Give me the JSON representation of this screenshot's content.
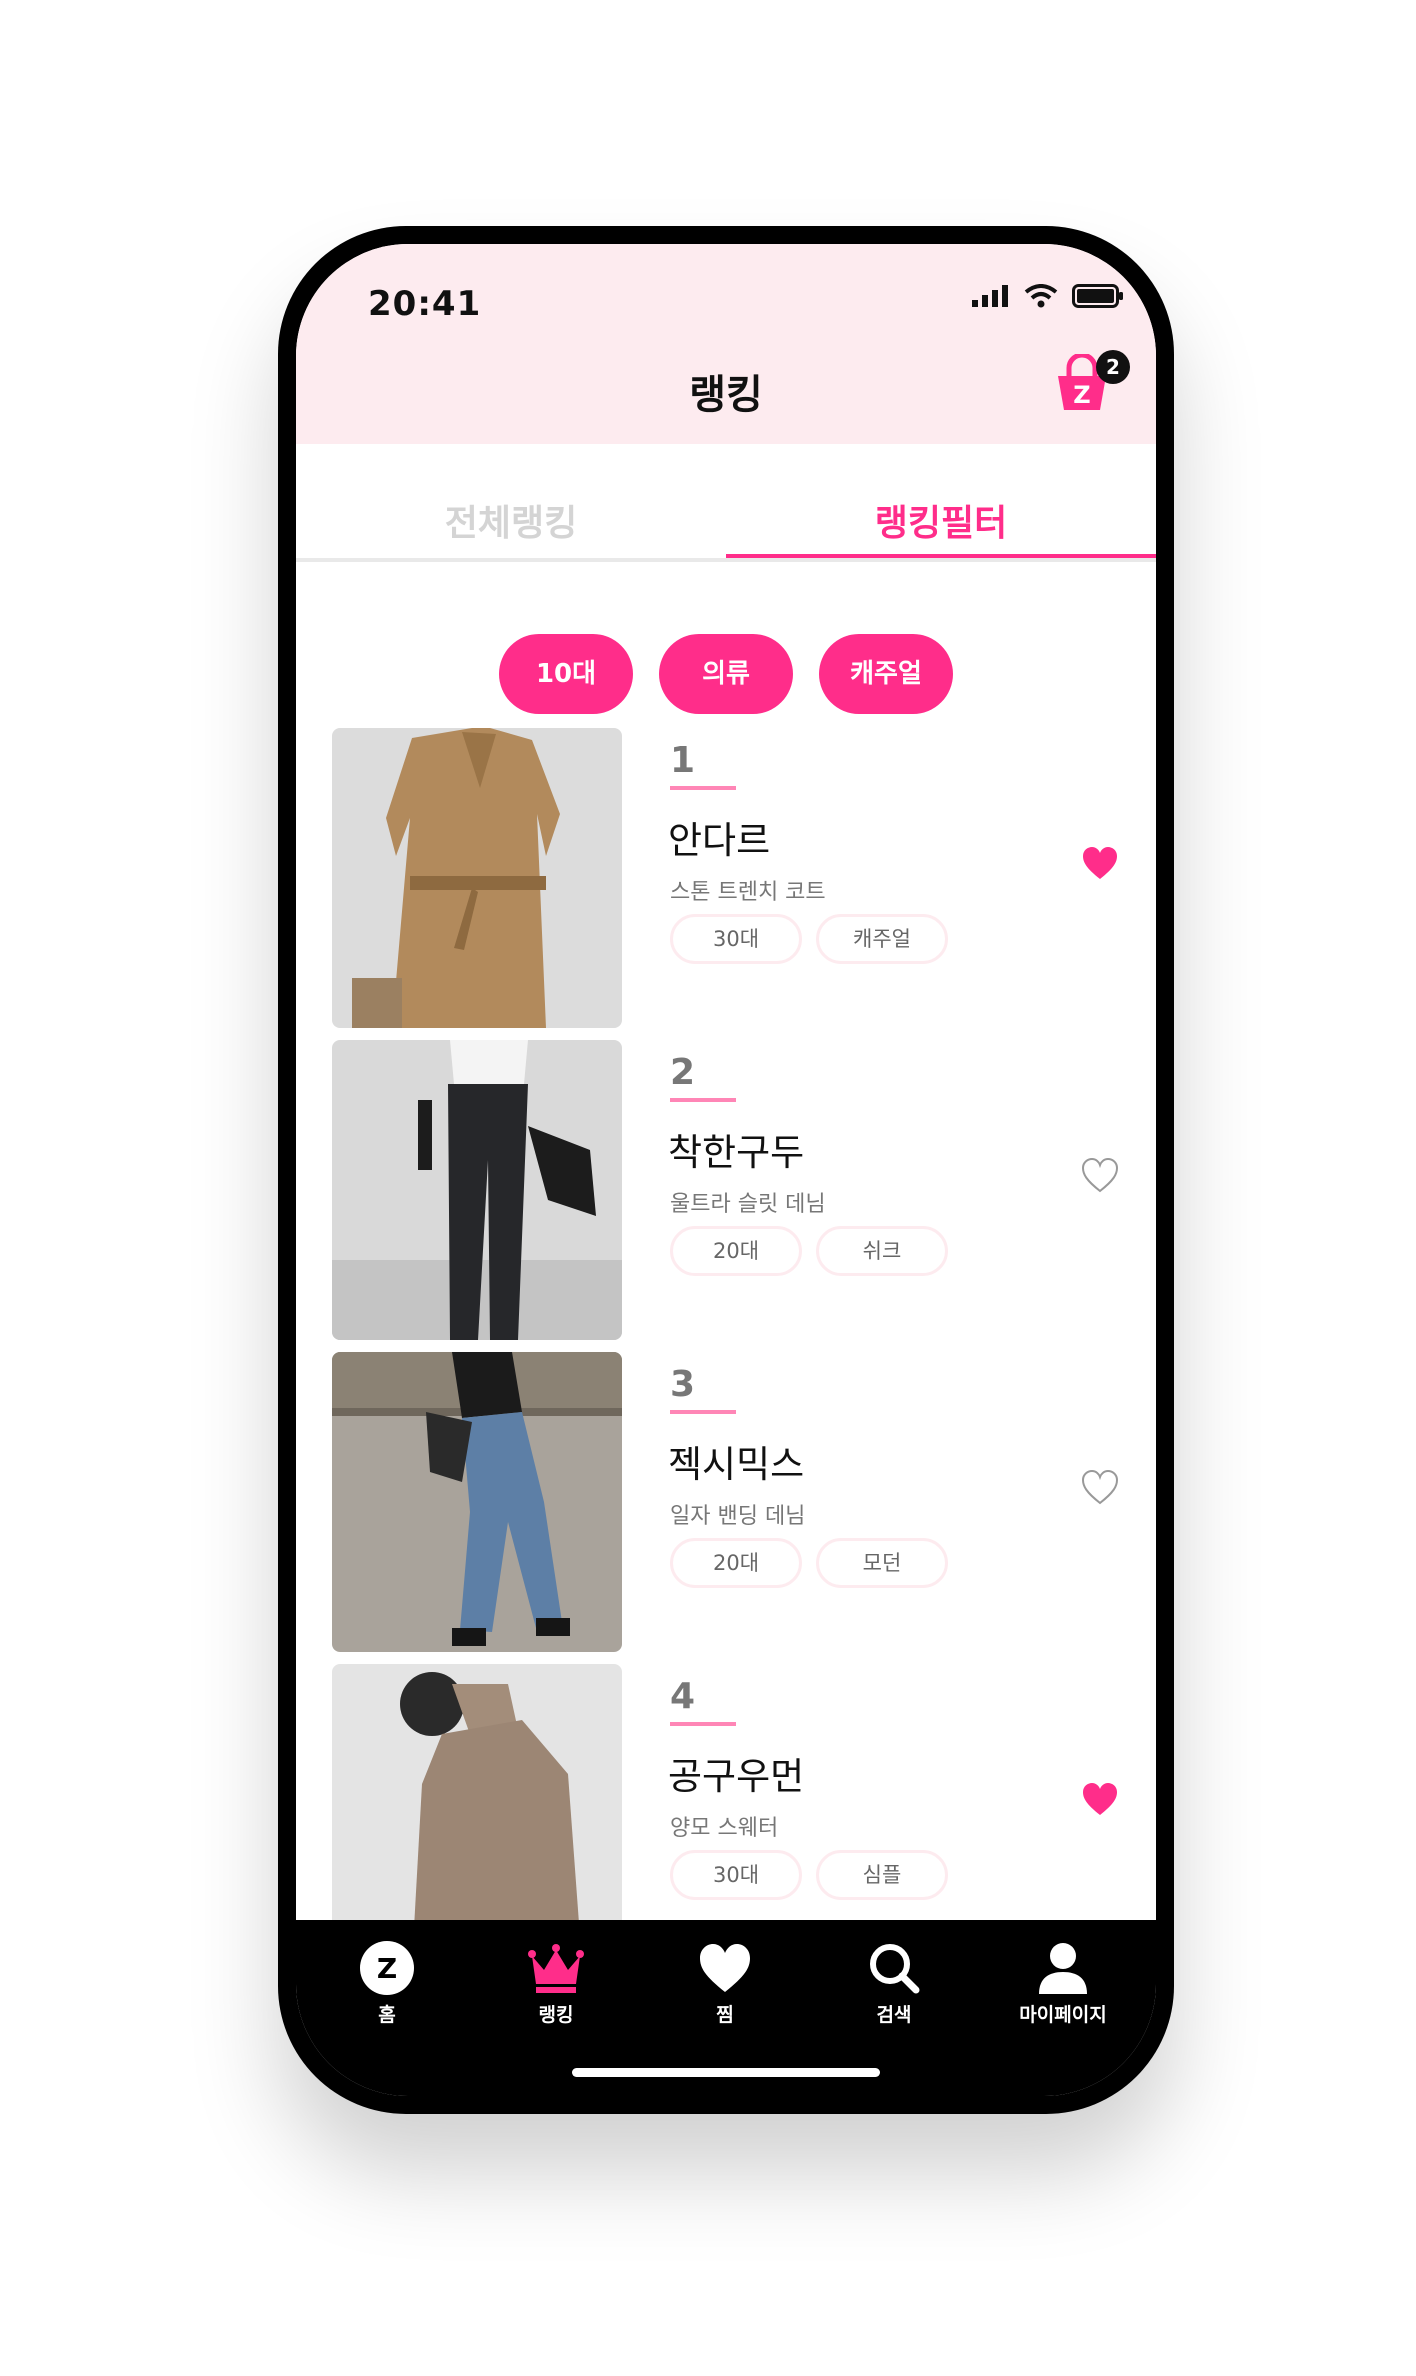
{
  "status_bar": {
    "time": "20:41"
  },
  "header": {
    "title": "랭킹",
    "cart_count": "2"
  },
  "tabs": [
    {
      "label": "전체랭킹"
    },
    {
      "label": "랭킹필터"
    }
  ],
  "filters": [
    {
      "label": "10대"
    },
    {
      "label": "의류"
    },
    {
      "label": "캐주얼"
    }
  ],
  "ranking": [
    {
      "rank": "1",
      "brand": "안다르",
      "product": "스톤 트렌치 코트",
      "tags": [
        "30대",
        "캐주얼"
      ],
      "liked": true
    },
    {
      "rank": "2",
      "brand": "착한구두",
      "product": "울트라 슬릿 데님",
      "tags": [
        "20대",
        "쉬크"
      ],
      "liked": false
    },
    {
      "rank": "3",
      "brand": "젝시믹스",
      "product": "일자 밴딩 데님",
      "tags": [
        "20대",
        "모던"
      ],
      "liked": false
    },
    {
      "rank": "4",
      "brand": "공구우먼",
      "product": "양모 스웨터",
      "tags": [
        "30대",
        "심플"
      ],
      "liked": true
    }
  ],
  "bottom_nav": [
    {
      "label": "홈"
    },
    {
      "label": "랭킹"
    },
    {
      "label": "찜"
    },
    {
      "label": "검색"
    },
    {
      "label": "마이페이지"
    }
  ],
  "colors": {
    "accent": "#ff2d8a",
    "header_bg": "#fdebef",
    "tabbar_bg": "#000000"
  }
}
